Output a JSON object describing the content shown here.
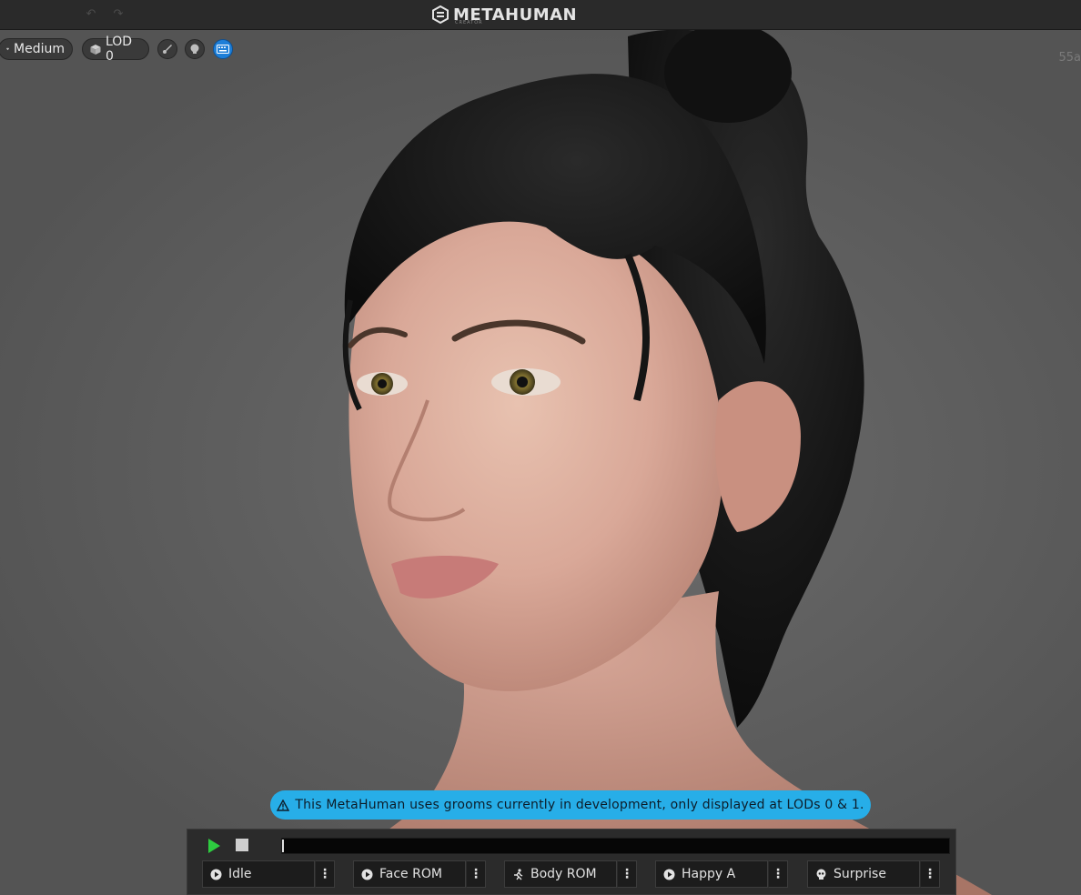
{
  "app": {
    "logo_text": "METAHUMAN",
    "logo_subtext": "CREATOR"
  },
  "toolbar": {
    "quality_label": "Medium",
    "lod_label": "LOD 0"
  },
  "viewport": {
    "fps_text": "55a"
  },
  "warning": {
    "text": "This MetaHuman uses grooms currently in development, only displayed at LODs 0 & 1."
  },
  "playback": {
    "progress": 0.0
  },
  "animations": [
    {
      "label": "Idle",
      "icon": "play-circle-icon"
    },
    {
      "label": "Face ROM",
      "icon": "play-circle-icon"
    },
    {
      "label": "Body ROM",
      "icon": "running-person-icon"
    },
    {
      "label": "Happy A",
      "icon": "play-circle-icon"
    },
    {
      "label": "Surprise",
      "icon": "skull-icon"
    }
  ],
  "colors": {
    "warning_bg": "#27aee8",
    "play_green": "#2ecc40",
    "active_toggle": "#1e7fd8"
  }
}
